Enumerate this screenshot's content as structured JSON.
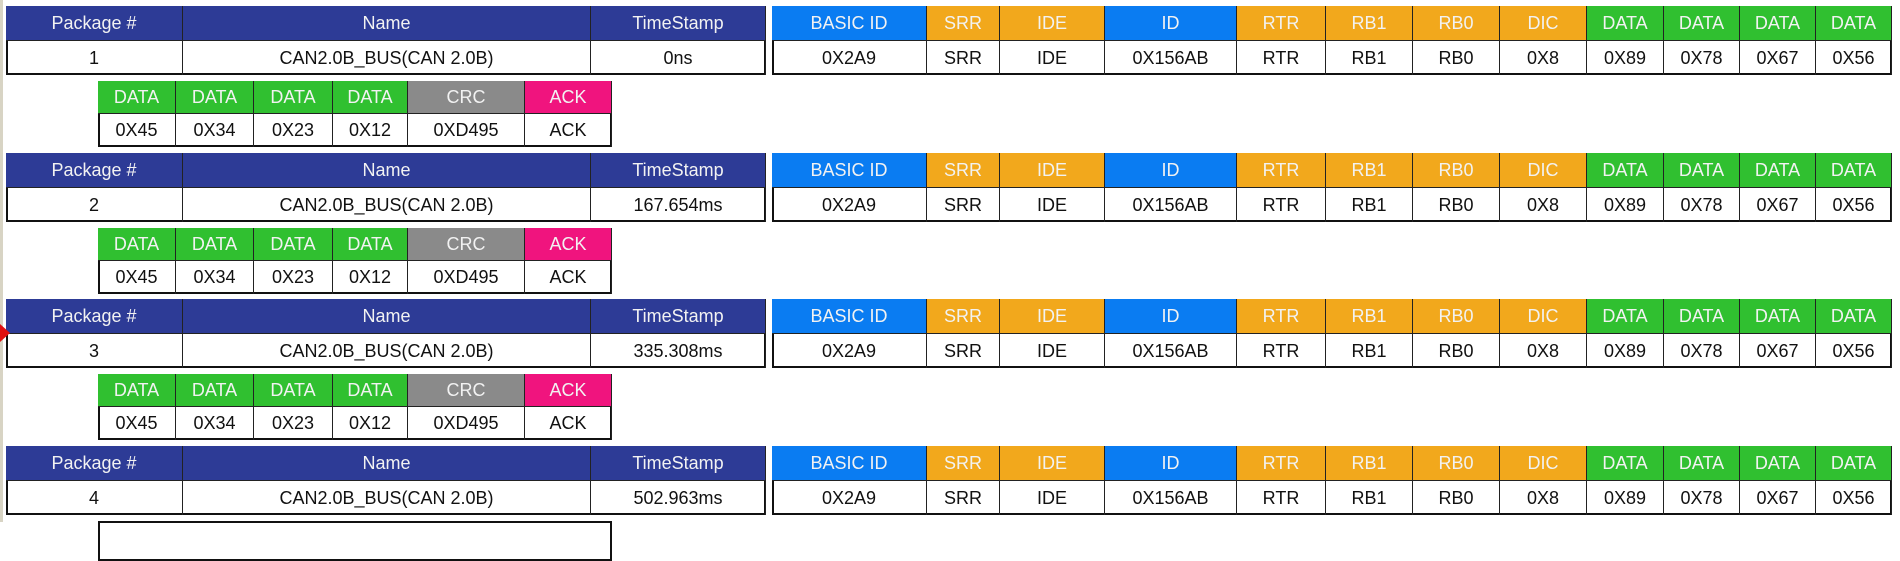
{
  "colors": {
    "header_navy": "#2d3b96",
    "basic_id_blue": "#0a7cf2",
    "control_orange": "#f2a81c",
    "data_green": "#30c030",
    "crc_gray": "#8a8a8a",
    "ack_pink": "#f0147e",
    "selection_marker": "#e01010"
  },
  "main_headers": [
    "Package #",
    "Name",
    "TimeStamp"
  ],
  "field_headers": [
    {
      "label": "BASIC ID",
      "color": "basic_id_blue"
    },
    {
      "label": "SRR",
      "color": "control_orange"
    },
    {
      "label": "IDE",
      "color": "control_orange"
    },
    {
      "label": "ID",
      "color": "basic_id_blue"
    },
    {
      "label": "RTR",
      "color": "control_orange"
    },
    {
      "label": "RB1",
      "color": "control_orange"
    },
    {
      "label": "RB0",
      "color": "control_orange"
    },
    {
      "label": "DIC",
      "color": "control_orange"
    },
    {
      "label": "DATA",
      "color": "data_green"
    },
    {
      "label": "DATA",
      "color": "data_green"
    },
    {
      "label": "DATA",
      "color": "data_green"
    },
    {
      "label": "DATA",
      "color": "data_green"
    }
  ],
  "tail_headers": [
    {
      "label": "DATA",
      "color": "data_green"
    },
    {
      "label": "DATA",
      "color": "data_green"
    },
    {
      "label": "DATA",
      "color": "data_green"
    },
    {
      "label": "DATA",
      "color": "data_green"
    },
    {
      "label": "CRC",
      "color": "crc_gray"
    },
    {
      "label": "ACK",
      "color": "ack_pink"
    }
  ],
  "packages": [
    {
      "number": "1",
      "name": "CAN2.0B_BUS(CAN 2.0B)",
      "timestamp": "0ns",
      "fields": [
        "0X2A9",
        "SRR",
        "IDE",
        "0X156AB",
        "RTR",
        "RB1",
        "RB0",
        "0X8",
        "0X89",
        "0X78",
        "0X67",
        "0X56"
      ],
      "tail": [
        "0X45",
        "0X34",
        "0X23",
        "0X12",
        "0XD495",
        "ACK"
      ],
      "selected": false
    },
    {
      "number": "2",
      "name": "CAN2.0B_BUS(CAN 2.0B)",
      "timestamp": "167.654ms",
      "fields": [
        "0X2A9",
        "SRR",
        "IDE",
        "0X156AB",
        "RTR",
        "RB1",
        "RB0",
        "0X8",
        "0X89",
        "0X78",
        "0X67",
        "0X56"
      ],
      "tail": [
        "0X45",
        "0X34",
        "0X23",
        "0X12",
        "0XD495",
        "ACK"
      ],
      "selected": false
    },
    {
      "number": "3",
      "name": "CAN2.0B_BUS(CAN 2.0B)",
      "timestamp": "335.308ms",
      "fields": [
        "0X2A9",
        "SRR",
        "IDE",
        "0X156AB",
        "RTR",
        "RB1",
        "RB0",
        "0X8",
        "0X89",
        "0X78",
        "0X67",
        "0X56"
      ],
      "tail": [
        "0X45",
        "0X34",
        "0X23",
        "0X12",
        "0XD495",
        "ACK"
      ],
      "selected": true
    },
    {
      "number": "4",
      "name": "CAN2.0B_BUS(CAN 2.0B)",
      "timestamp": "502.963ms",
      "fields": [
        "0X2A9",
        "SRR",
        "IDE",
        "0X156AB",
        "RTR",
        "RB1",
        "RB0",
        "0X8",
        "0X89",
        "0X78",
        "0X67",
        "0X56"
      ],
      "tail": [],
      "selected": false
    }
  ]
}
